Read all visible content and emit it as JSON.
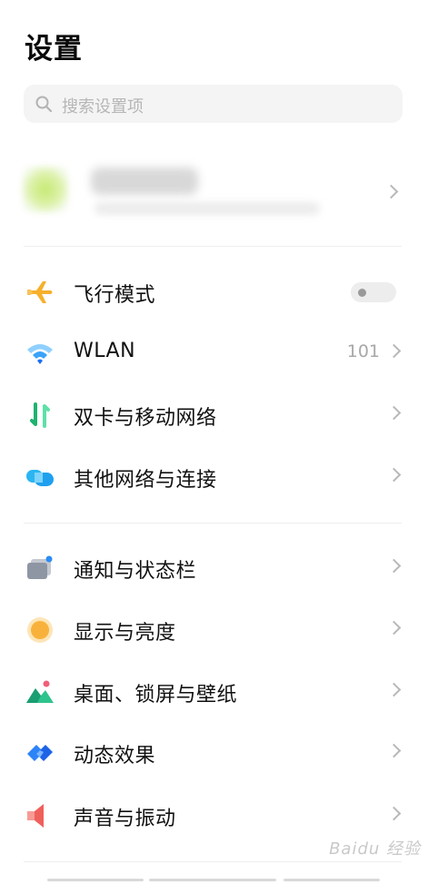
{
  "header": {
    "title": "设置"
  },
  "search": {
    "placeholder": "搜索设置项"
  },
  "settings": {
    "airplane": {
      "label": "飞行模式",
      "enabled": false
    },
    "wlan": {
      "label": "WLAN",
      "value": "101"
    },
    "dual_sim": {
      "label": "双卡与移动网络"
    },
    "other_network": {
      "label": "其他网络与连接"
    },
    "notifications": {
      "label": "通知与状态栏"
    },
    "display": {
      "label": "显示与亮度"
    },
    "desktop": {
      "label": "桌面、锁屏与壁纸"
    },
    "animations": {
      "label": "动态效果"
    },
    "sound": {
      "label": "声音与振动"
    }
  },
  "watermark": {
    "text": "Baidu 经验"
  },
  "colors": {
    "airplane_icon": "#f6b02b",
    "wifi_icon": "#1c8cf6",
    "sim_green": "#26c281",
    "network_icon": "#27b4f1",
    "display_icon": "#f8b23c",
    "desktop_icon": "#30c28f",
    "animation_icon": "#2c84f7",
    "sound_icon": "#f0605a"
  },
  "icons": [
    "search-icon",
    "airplane-icon",
    "wifi-icon",
    "dual-sim-icon",
    "network-icon",
    "notification-icon",
    "display-icon",
    "desktop-icon",
    "animation-icon",
    "sound-icon",
    "chevron-right-icon"
  ]
}
